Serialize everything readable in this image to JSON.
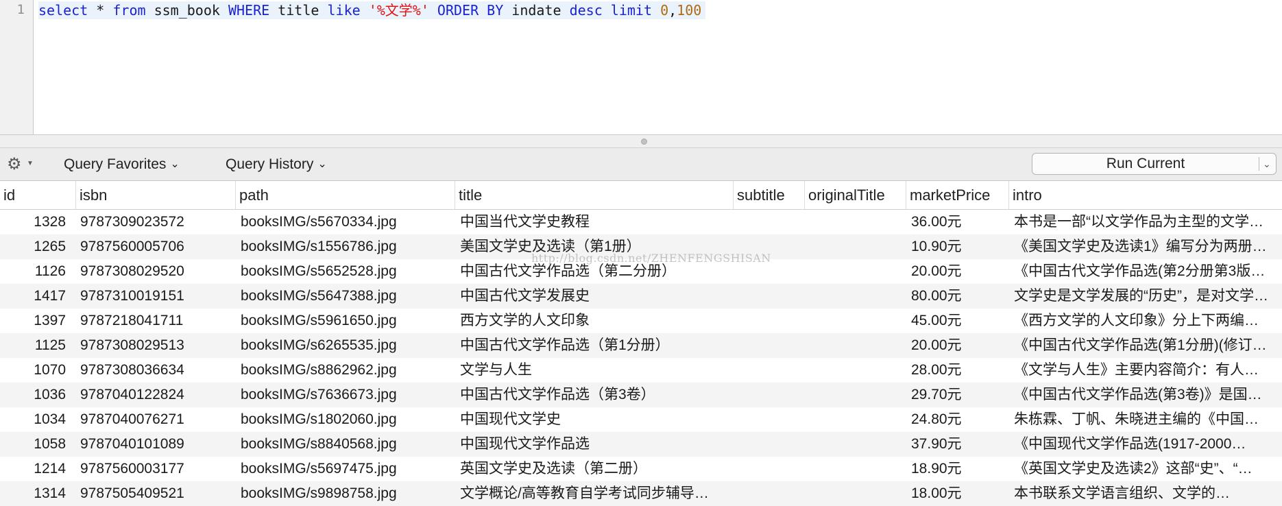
{
  "editor": {
    "line_number": "1",
    "tokens": [
      {
        "text": "select",
        "kind": "kw"
      },
      {
        "text": " * ",
        "kind": "id"
      },
      {
        "text": "from",
        "kind": "kw"
      },
      {
        "text": " ssm_book ",
        "kind": "id"
      },
      {
        "text": "WHERE",
        "kind": "kw"
      },
      {
        "text": " title ",
        "kind": "id"
      },
      {
        "text": "like",
        "kind": "kw"
      },
      {
        "text": " ",
        "kind": "id"
      },
      {
        "text": "'%文学%'",
        "kind": "str"
      },
      {
        "text": " ",
        "kind": "id"
      },
      {
        "text": "ORDER BY",
        "kind": "kw"
      },
      {
        "text": " indate ",
        "kind": "id"
      },
      {
        "text": "desc",
        "kind": "kw"
      },
      {
        "text": " ",
        "kind": "id"
      },
      {
        "text": "limit",
        "kind": "kw"
      },
      {
        "text": " ",
        "kind": "id"
      },
      {
        "text": "0",
        "kind": "num"
      },
      {
        "text": ",",
        "kind": "id"
      },
      {
        "text": "100",
        "kind": "num"
      }
    ]
  },
  "toolbar": {
    "gear_icon": "gear-icon",
    "favorites_label": "Query Favorites",
    "history_label": "Query History",
    "run_label": "Run Current"
  },
  "columns": [
    "id",
    "isbn",
    "path",
    "title",
    "subtitle",
    "originalTitle",
    "marketPrice",
    "intro"
  ],
  "rows": [
    {
      "id": "1328",
      "isbn": "9787309023572",
      "path": "booksIMG/s5670334.jpg",
      "title": "中国当代文学史教程",
      "subtitle": "",
      "originalTitle": "",
      "marketPrice": "36.00元",
      "intro": "本书是一部“以文学作品为主型的文学…"
    },
    {
      "id": "1265",
      "isbn": "9787560005706",
      "path": "booksIMG/s1556786.jpg",
      "title": "美国文学史及选读（第1册）",
      "subtitle": "",
      "originalTitle": "",
      "marketPrice": "10.90元",
      "intro": "《美国文学史及选读1》编写分为两册…"
    },
    {
      "id": "1126",
      "isbn": "9787308029520",
      "path": "booksIMG/s5652528.jpg",
      "title": "中国古代文学作品选（第二分册）",
      "subtitle": "",
      "originalTitle": "",
      "marketPrice": "20.00元",
      "intro": "《中国古代文学作品选(第2分册第3版…"
    },
    {
      "id": "1417",
      "isbn": "9787310019151",
      "path": "booksIMG/s5647388.jpg",
      "title": "中国古代文学发展史",
      "subtitle": "",
      "originalTitle": "",
      "marketPrice": "80.00元",
      "intro": "文学史是文学发展的“历史”，是对文学…"
    },
    {
      "id": "1397",
      "isbn": "9787218041711",
      "path": "booksIMG/s5961650.jpg",
      "title": "西方文学的人文印象",
      "subtitle": "",
      "originalTitle": "",
      "marketPrice": "45.00元",
      "intro": "《西方文学的人文印象》分上下两编…"
    },
    {
      "id": "1125",
      "isbn": "9787308029513",
      "path": "booksIMG/s6265535.jpg",
      "title": "中国古代文学作品选（第1分册）",
      "subtitle": "",
      "originalTitle": "",
      "marketPrice": "20.00元",
      "intro": "《中国古代文学作品选(第1分册)(修订…"
    },
    {
      "id": "1070",
      "isbn": "9787308036634",
      "path": "booksIMG/s8862962.jpg",
      "title": "文学与人生",
      "subtitle": "",
      "originalTitle": "",
      "marketPrice": "28.00元",
      "intro": "《文学与人生》主要内容简介：有人…"
    },
    {
      "id": "1036",
      "isbn": "9787040122824",
      "path": "booksIMG/s7636673.jpg",
      "title": "中国古代文学作品选（第3卷）",
      "subtitle": "",
      "originalTitle": "",
      "marketPrice": "29.70元",
      "intro": "《中国古代文学作品选(第3卷)》是国…"
    },
    {
      "id": "1034",
      "isbn": "9787040076271",
      "path": "booksIMG/s1802060.jpg",
      "title": "中国现代文学史",
      "subtitle": "",
      "originalTitle": "",
      "marketPrice": "24.80元",
      "intro": "朱栋霖、丁帆、朱晓进主编的《中国…"
    },
    {
      "id": "1058",
      "isbn": "9787040101089",
      "path": "booksIMG/s8840568.jpg",
      "title": "中国现代文学作品选",
      "subtitle": "",
      "originalTitle": "",
      "marketPrice": "37.90元",
      "intro": "《中国现代文学作品选(1917-2000…"
    },
    {
      "id": "1214",
      "isbn": "9787560003177",
      "path": "booksIMG/s5697475.jpg",
      "title": "英国文学史及选读（第二册）",
      "subtitle": "",
      "originalTitle": "",
      "marketPrice": "18.90元",
      "intro": "《英国文学史及选读2》这部“史”、“…"
    },
    {
      "id": "1314",
      "isbn": "9787505409521",
      "path": "booksIMG/s9898758.jpg",
      "title": "文学概论/高等教育自学考试同步辅导…",
      "subtitle": "",
      "originalTitle": "",
      "marketPrice": "18.00元",
      "intro": "本书联系文学语言组织、文学的…"
    }
  ],
  "watermark": "http://blog.csdn.net/ZHENFENGSHISAN"
}
